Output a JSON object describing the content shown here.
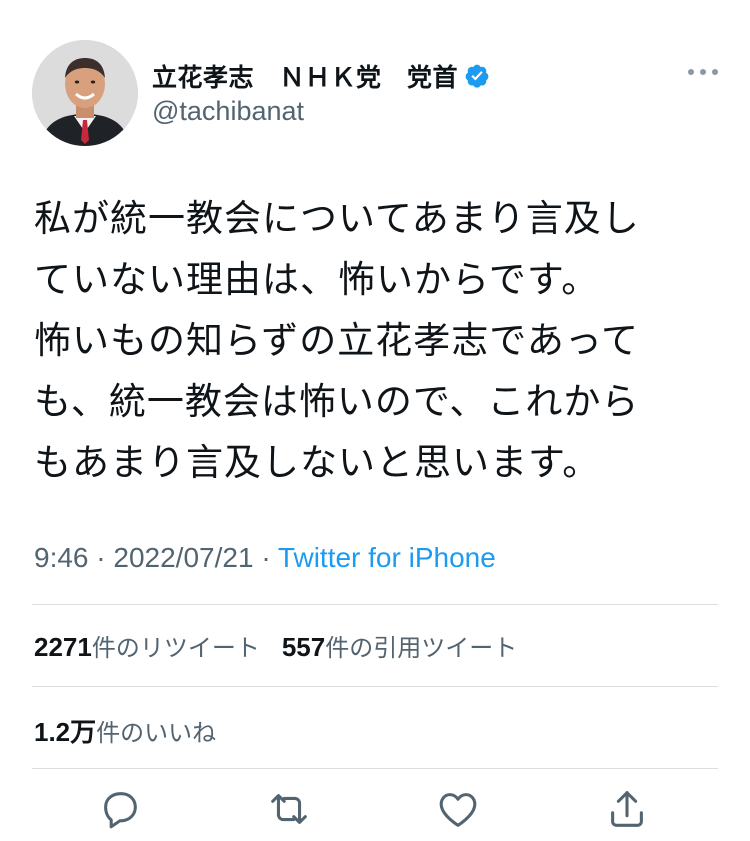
{
  "user": {
    "display_name": "立花孝志　ＮＨＫ党　党首",
    "handle": "@tachibanat",
    "verified": true
  },
  "tweet": {
    "text": "私が統一教会についてあまり言及し\nていない理由は、怖いからです。\n怖いもの知らずの立花孝志であって\nも、統一教会は怖いので、これから\nもあまり言及しないと思います。",
    "time": "9:46",
    "separator": "·",
    "date": "2022/07/21",
    "source": "Twitter for iPhone"
  },
  "stats": {
    "retweets_count": "2271",
    "retweets_label": "件のリツイート",
    "quotes_count": "557",
    "quotes_label": "件の引用ツイート",
    "likes_count": "1.2万",
    "likes_label": "件のいいね"
  },
  "colors": {
    "text": "#0f1419",
    "secondary": "#536471",
    "link": "#1d9bf0",
    "divider": "#dcdfe2",
    "icon": "#536471",
    "verified": "#1d9bf0"
  },
  "icons": {
    "more": "more-horizontal-icon",
    "reply": "reply-icon",
    "retweet": "retweet-icon",
    "like": "heart-icon",
    "share": "share-icon",
    "verified": "verified-badge-icon"
  }
}
